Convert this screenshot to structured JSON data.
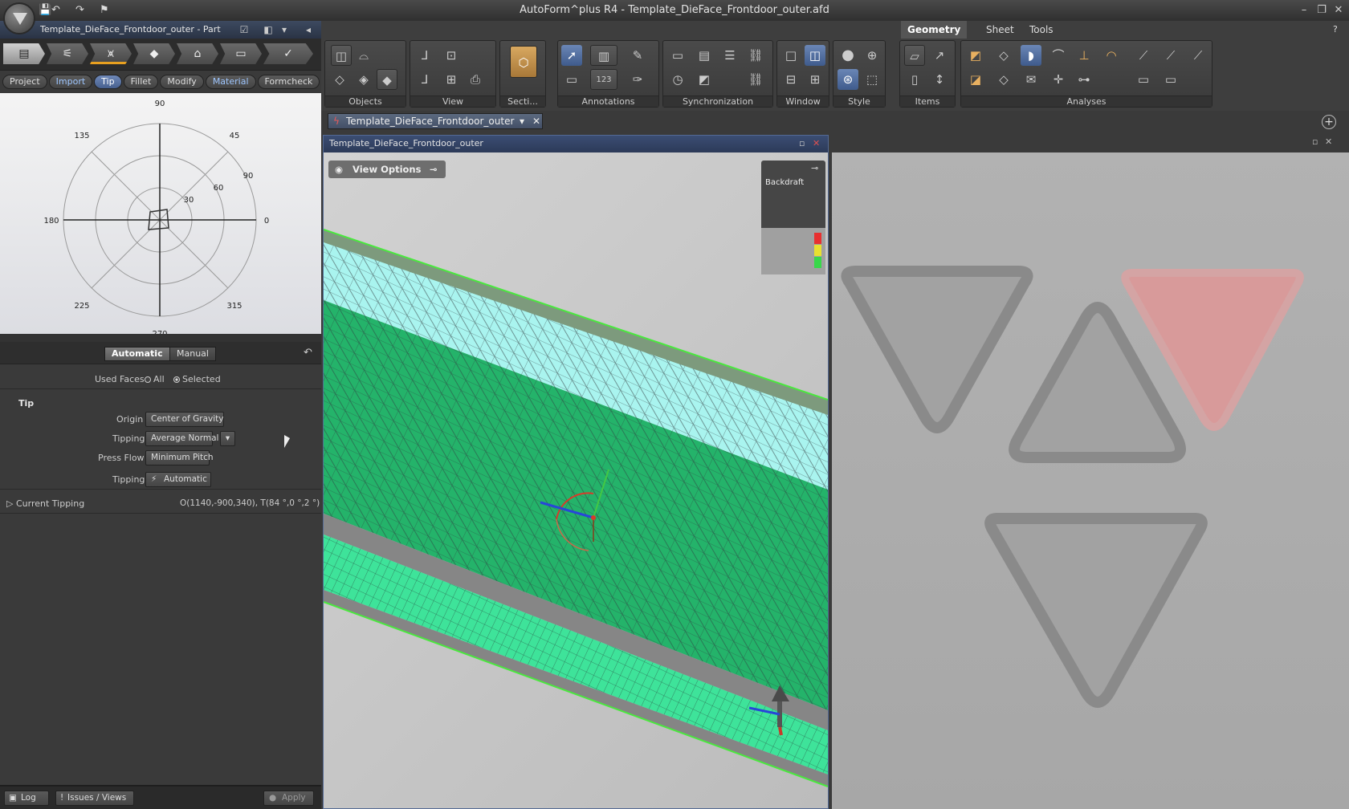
{
  "window": {
    "title": "AutoForm^plus R4 - Template_DieFace_Frontdoor_outer.afd",
    "minimize": "–",
    "restore": "❐",
    "close": "✕",
    "help": "?"
  },
  "quick_access": {
    "save": "💾",
    "undo": "↶",
    "redo": "↷",
    "tool": "⚑"
  },
  "doc_panel": {
    "title": "Template_DieFace_Frontdoor_outer  -  Part"
  },
  "workflow_icons": [
    "▤",
    "⚟",
    "⩙",
    "◆",
    "⌂",
    "▭",
    "✓"
  ],
  "process_tabs": [
    {
      "label": "Project",
      "state": "normal"
    },
    {
      "label": "Import",
      "state": "accent"
    },
    {
      "label": "Tip",
      "state": "active"
    },
    {
      "label": "Fillet",
      "state": "normal"
    },
    {
      "label": "Modify",
      "state": "normal"
    },
    {
      "label": "Material",
      "state": "accent"
    },
    {
      "label": "Formcheck",
      "state": "normal"
    }
  ],
  "polar_plot": {
    "angle_labels": [
      "90",
      "45",
      "0",
      "315",
      "270",
      "225",
      "180",
      "135"
    ],
    "radius_labels": [
      "30",
      "60",
      "90"
    ]
  },
  "tip_form": {
    "mode_automatic": "Automatic",
    "mode_manual": "Manual",
    "used_faces_label": "Used Faces",
    "used_faces_all": "All",
    "used_faces_selected": "Selected",
    "section_title": "Tip",
    "origin_label": "Origin",
    "origin_value": "Center of Gravity",
    "tipping_label": "Tipping",
    "tipping_value": "Average Normal",
    "press_flow_label": "Press Flow",
    "press_flow_value": "Minimum Pitch",
    "tipping2_label": "Tipping",
    "tipping2_value": "Automatic",
    "current_tipping_label": "Current Tipping",
    "current_tipping_value": "O(1140,-900,340), T(84 °,0 °,2 °)"
  },
  "bottom_bar": {
    "log": "Log",
    "issues": "Issues / Views",
    "apply": "Apply"
  },
  "ribbon": {
    "tabs": [
      "Geometry",
      "Sheet",
      "Tools"
    ],
    "groups": [
      "Objects",
      "View",
      "Secti...",
      "Annotations",
      "Synchronization",
      "Window",
      "Style",
      "Items",
      "Analyses"
    ]
  },
  "doc_tab": {
    "label": "Template_DieFace_Frontdoor_outer"
  },
  "viewport": {
    "title": "Template_DieFace_Frontdoor_outer",
    "view_options": "View Options",
    "backdraft": "Backdraft"
  }
}
